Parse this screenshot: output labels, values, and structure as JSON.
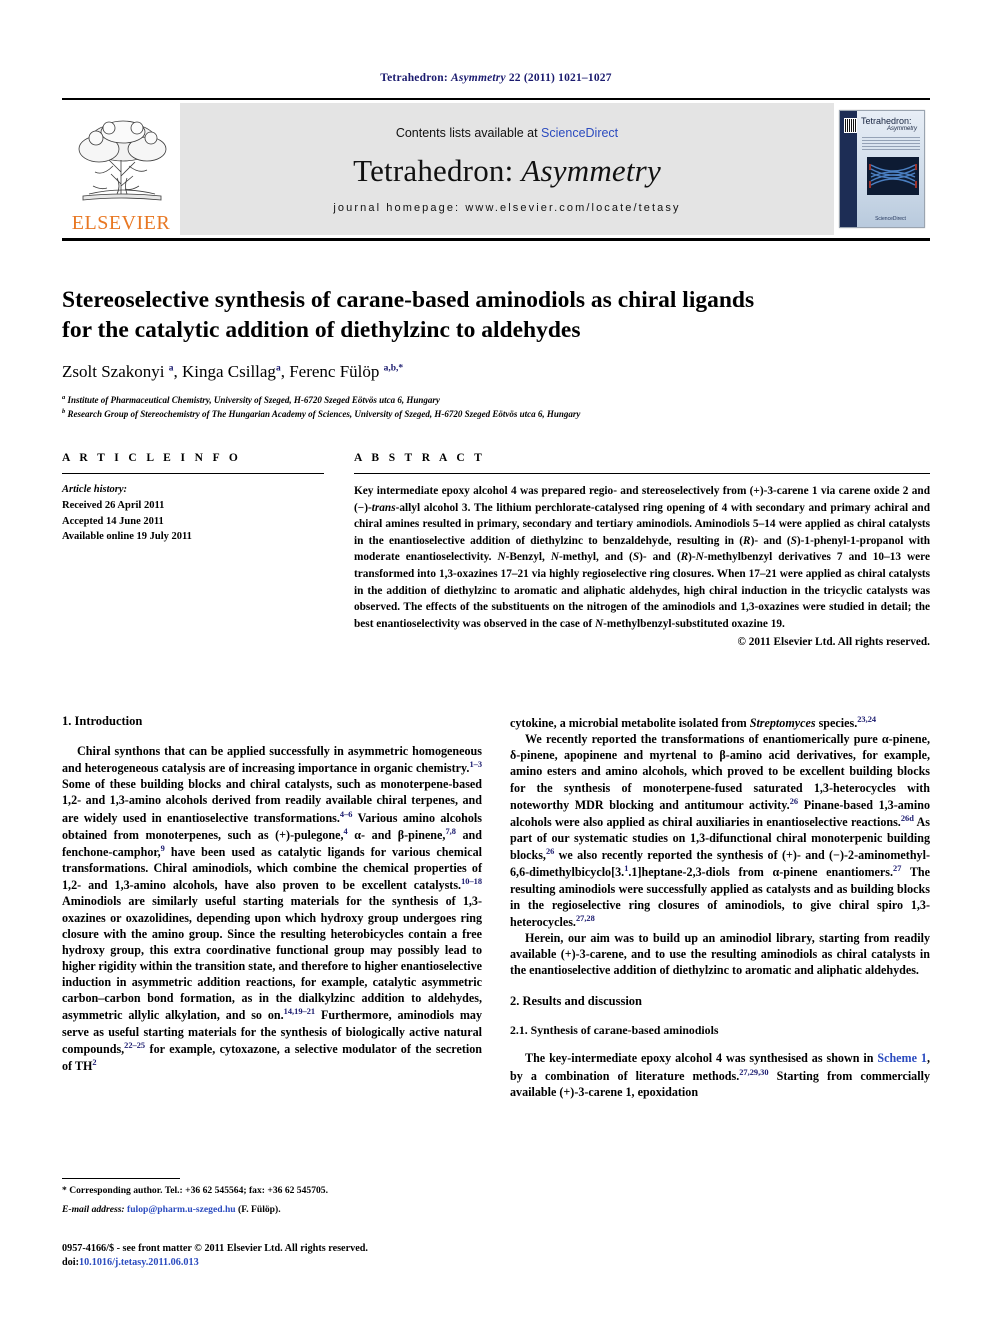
{
  "running_head": {
    "journal": "Tetrahedron:",
    "journal_italic": "Asymmetry",
    "citation": "22 (2011) 1021–1027"
  },
  "masthead": {
    "contents_prefix": "Contents lists available at ",
    "sciencedirect": "ScienceDirect",
    "journal_title_main": "Tetrahedron: ",
    "journal_title_italic": "Asymmetry",
    "homepage": "journal homepage: www.elsevier.com/locate/tetasy",
    "publisher": "ELSEVIER",
    "cover": {
      "title": "Tetrahedron:",
      "subtitle": "Asymmetry",
      "footer": "ScienceDirect"
    }
  },
  "article": {
    "title_line1": "Stereoselective synthesis of carane-based aminodiols as chiral ligands",
    "title_line2": "for the catalytic addition of diethylzinc to aldehydes",
    "authors": "Zsolt Szakonyi a, Kinga Csillag a, Ferenc Fülöp a,b,*",
    "affiliation_a": "Institute of Pharmaceutical Chemistry, University of Szeged, H-6720 Szeged Eötvös utca 6, Hungary",
    "affiliation_b": "Research Group of Stereochemistry of The Hungarian Academy of Sciences, University of Szeged, H-6720 Szeged Eötvös utca 6, Hungary"
  },
  "article_info": {
    "heading": "A R T I C L E   I N F O",
    "history_label": "Article history:",
    "received": "Received 26 April 2011",
    "accepted": "Accepted 14 June 2011",
    "available": "Available online 19 July 2011"
  },
  "abstract": {
    "heading": "A B S T R A C T",
    "body": "Key intermediate epoxy alcohol 4 was prepared regio- and stereoselectively from (+)-3-carene 1 via carene oxide 2 and (−)-trans-allyl alcohol 3. The lithium perchlorate-catalysed ring opening of 4 with secondary and primary achiral and chiral amines resulted in primary, secondary and tertiary aminodiols. Aminodiols 5–14 were applied as chiral catalysts in the enantioselective addition of diethylzinc to benzaldehyde, resulting in (R)- and (S)-1-phenyl-1-propanol with moderate enantioselectivity. N-Benzyl, N-methyl, and (S)- and (R)-N-methylbenzyl derivatives 7 and 10–13 were transformed into 1,3-oxazines 17–21 via highly regioselective ring closures. When 17–21 were applied as chiral catalysts in the addition of diethylzinc to aromatic and aliphatic aldehydes, high chiral induction in the tricyclic catalysts was observed. The effects of the substituents on the nitrogen of the aminodiols and 1,3-oxazines were studied in detail; the best enantioselectivity was observed in the case of N-methylbenzyl-substituted oxazine 19.",
    "copyright": "© 2011 Elsevier Ltd. All rights reserved."
  },
  "sections": {
    "introduction_heading": "1. Introduction",
    "results_heading": "2. Results and discussion",
    "synthesis_heading": "2.1. Synthesis of carane-based aminodiols"
  },
  "paragraphs": {
    "intro_p1": "Chiral synthons that can be applied successfully in asymmetric homogeneous and heterogeneous catalysis are of increasing importance in organic chemistry.1–3 Some of these building blocks and chiral catalysts, such as monoterpene-based 1,2- and 1,3-amino alcohols derived from readily available chiral terpenes, and are widely used in enantioselective transformations.4–6 Various amino alcohols obtained from monoterpenes, such as (+)-pulegone,4 α- and β-pinene,7,8 and fenchone-camphor,9 have been used as catalytic ligands for various chemical transformations. Chiral aminodiols, which combine the chemical properties of 1,2- and 1,3-amino alcohols, have also proven to be excellent catalysts.10–18 Aminodiols are similarly useful starting materials for the synthesis of 1,3-oxazines or oxazolidines, depending upon which hydroxy group undergoes ring closure with the amino group. Since the resulting heterobicycles contain a free hydroxy group, this extra coordinative functional group may possibly lead to higher rigidity within the transition state, and therefore to higher enantioselective induction in asymmetric addition reactions, for example, catalytic asymmetric carbon–carbon bond formation, as in the dialkylzinc addition to aldehydes, asymmetric allylic alkylation, and so on.14,19–21 Furthermore, aminodiols may serve as useful starting materials for the synthesis of biologically active natural compounds,22–25 for example, cytoxazone, a selective modulator of the secretion of TH2",
    "right_p1_cont": "cytokine, a microbial metabolite isolated from Streptomyces species.23,24",
    "right_p2": "We recently reported the transformations of enantiomerically pure α-pinene, δ-pinene, apopinene and myrtenal to β-amino acid derivatives, for example, amino esters and amino alcohols, which proved to be excellent building blocks for the synthesis of monoterpene-fused saturated 1,3-heterocycles with noteworthy MDR blocking and antitumour activity.26 Pinane-based 1,3-amino alcohols were also applied as chiral auxiliaries in enantioselective reactions.26d As part of our systematic studies on 1,3-difunctional chiral monoterpenic building blocks,26 we also recently reported the synthesis of (+)- and (−)-2-aminomethyl-6,6-dimethylbicyclo[3.1.1]heptane-2,3-diols from α-pinene enantiomers.27 The resulting aminodiols were successfully applied as catalysts and as building blocks in the regioselective ring closures of aminodiols, to give chiral spiro 1,3-heterocycles.27,28",
    "right_p3": "Herein, our aim was to build up an aminodiol library, starting from readily available (+)-3-carene, and to use the resulting aminodiols as chiral catalysts in the enantioselective addition of diethylzinc to aromatic and aliphatic aldehydes.",
    "right_p4": "The key-intermediate epoxy alcohol 4 was synthesised as shown in Scheme 1, by a combination of literature methods.27,29,30 Starting from commercially available (+)-3-carene 1, epoxidation"
  },
  "footnotes": {
    "corresponding": "* Corresponding author. Tel.: +36 62 545564; fax: +36 62 545705.",
    "email_label": "E-mail address: ",
    "email": "fulop@pharm.u-szeged.hu",
    "email_suffix": " (F. Fülöp).",
    "issn_line": "0957-4166/$ - see front matter © 2011 Elsevier Ltd. All rights reserved.",
    "doi_label": "doi:",
    "doi": "10.1016/j.tetasy.2011.06.013"
  },
  "colors": {
    "link_blue": "#2b4bbf",
    "ref_blue": "#1a1a6e",
    "elsevier_orange": "#E87722",
    "masthead_grey": "#e4e4e4"
  }
}
